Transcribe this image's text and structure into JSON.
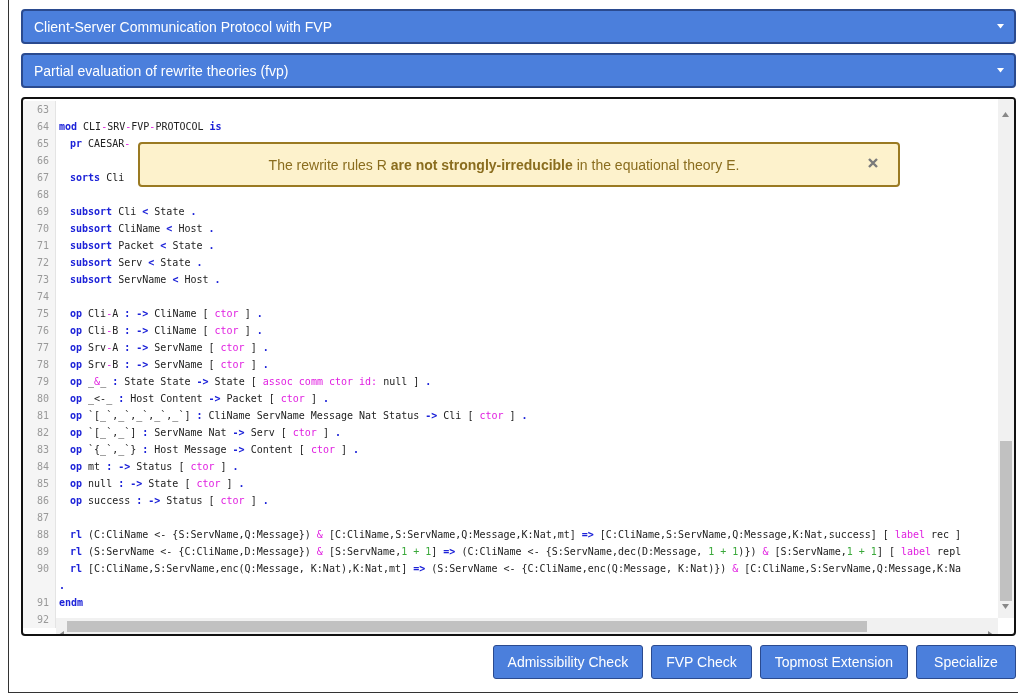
{
  "sections": [
    {
      "title": "Client-Server Communication Protocol with FVP",
      "expanded": false
    },
    {
      "title": "Partial evaluation of rewrite theories (fvp)",
      "expanded": false
    }
  ],
  "editor": {
    "lines": [
      {
        "number": "63"
      },
      {
        "number": "64",
        "indented": false,
        "tokens": [
          {
            "kind": "keyword",
            "text": "mod"
          },
          {
            "kind": "text",
            "text": " CLI"
          },
          {
            "kind": "attribute",
            "text": "-"
          },
          {
            "kind": "text",
            "text": "SRV"
          },
          {
            "kind": "attribute",
            "text": "-"
          },
          {
            "kind": "text",
            "text": "FVP"
          },
          {
            "kind": "attribute",
            "text": "-"
          },
          {
            "kind": "text",
            "text": "PROTOCOL "
          },
          {
            "kind": "keyword",
            "text": "is"
          }
        ]
      },
      {
        "number": "65",
        "indented": true,
        "tokens": [
          {
            "kind": "keyword",
            "text": "pr"
          },
          {
            "kind": "text",
            "text": " CAESAR"
          },
          {
            "kind": "attribute",
            "text": "-"
          }
        ]
      },
      {
        "number": "66"
      },
      {
        "number": "67",
        "indented": true,
        "tokens": [
          {
            "kind": "keyword",
            "text": "sorts"
          },
          {
            "kind": "text",
            "text": " Cli"
          }
        ]
      },
      {
        "number": "68"
      },
      {
        "number": "69",
        "indented": true,
        "tokens": [
          {
            "kind": "keyword",
            "text": "subsort"
          },
          {
            "kind": "text",
            "text": " Cli "
          },
          {
            "kind": "keyword",
            "text": "<"
          },
          {
            "kind": "text",
            "text": " State "
          },
          {
            "kind": "keyword",
            "text": "."
          }
        ]
      },
      {
        "number": "70",
        "indented": true,
        "tokens": [
          {
            "kind": "keyword",
            "text": "subsort"
          },
          {
            "kind": "text",
            "text": " CliName "
          },
          {
            "kind": "keyword",
            "text": "<"
          },
          {
            "kind": "text",
            "text": " Host "
          },
          {
            "kind": "keyword",
            "text": "."
          }
        ]
      },
      {
        "number": "71",
        "indented": true,
        "tokens": [
          {
            "kind": "keyword",
            "text": "subsort"
          },
          {
            "kind": "text",
            "text": " Packet "
          },
          {
            "kind": "keyword",
            "text": "<"
          },
          {
            "kind": "text",
            "text": " State "
          },
          {
            "kind": "keyword",
            "text": "."
          }
        ]
      },
      {
        "number": "72",
        "indented": true,
        "tokens": [
          {
            "kind": "keyword",
            "text": "subsort"
          },
          {
            "kind": "text",
            "text": " Serv "
          },
          {
            "kind": "keyword",
            "text": "<"
          },
          {
            "kind": "text",
            "text": " State "
          },
          {
            "kind": "keyword",
            "text": "."
          }
        ]
      },
      {
        "number": "73",
        "indented": true,
        "tokens": [
          {
            "kind": "keyword",
            "text": "subsort"
          },
          {
            "kind": "text",
            "text": " ServName "
          },
          {
            "kind": "keyword",
            "text": "<"
          },
          {
            "kind": "text",
            "text": " Host "
          },
          {
            "kind": "keyword",
            "text": "."
          }
        ]
      },
      {
        "number": "74"
      },
      {
        "number": "75",
        "indented": true,
        "tokens": [
          {
            "kind": "keyword",
            "text": "op"
          },
          {
            "kind": "text",
            "text": " Cli"
          },
          {
            "kind": "attribute",
            "text": "-"
          },
          {
            "kind": "text",
            "text": "A "
          },
          {
            "kind": "keyword",
            "text": ": ->"
          },
          {
            "kind": "text",
            "text": " CliName [ "
          },
          {
            "kind": "attribute",
            "text": "ctor"
          },
          {
            "kind": "text",
            "text": " ] "
          },
          {
            "kind": "keyword",
            "text": "."
          }
        ]
      },
      {
        "number": "76",
        "indented": true,
        "tokens": [
          {
            "kind": "keyword",
            "text": "op"
          },
          {
            "kind": "text",
            "text": " Cli"
          },
          {
            "kind": "attribute",
            "text": "-"
          },
          {
            "kind": "text",
            "text": "B "
          },
          {
            "kind": "keyword",
            "text": ": ->"
          },
          {
            "kind": "text",
            "text": " CliName [ "
          },
          {
            "kind": "attribute",
            "text": "ctor"
          },
          {
            "kind": "text",
            "text": " ] "
          },
          {
            "kind": "keyword",
            "text": "."
          }
        ]
      },
      {
        "number": "77",
        "indented": true,
        "tokens": [
          {
            "kind": "keyword",
            "text": "op"
          },
          {
            "kind": "text",
            "text": " Srv"
          },
          {
            "kind": "attribute",
            "text": "-"
          },
          {
            "kind": "text",
            "text": "A "
          },
          {
            "kind": "keyword",
            "text": ": ->"
          },
          {
            "kind": "text",
            "text": " ServName [ "
          },
          {
            "kind": "attribute",
            "text": "ctor"
          },
          {
            "kind": "text",
            "text": " ] "
          },
          {
            "kind": "keyword",
            "text": "."
          }
        ]
      },
      {
        "number": "78",
        "indented": true,
        "tokens": [
          {
            "kind": "keyword",
            "text": "op"
          },
          {
            "kind": "text",
            "text": " Srv"
          },
          {
            "kind": "attribute",
            "text": "-"
          },
          {
            "kind": "text",
            "text": "B "
          },
          {
            "kind": "keyword",
            "text": ": ->"
          },
          {
            "kind": "text",
            "text": " ServName [ "
          },
          {
            "kind": "attribute",
            "text": "ctor"
          },
          {
            "kind": "text",
            "text": " ] "
          },
          {
            "kind": "keyword",
            "text": "."
          }
        ]
      },
      {
        "number": "79",
        "indented": true,
        "tokens": [
          {
            "kind": "keyword",
            "text": "op"
          },
          {
            "kind": "text",
            "text": " _"
          },
          {
            "kind": "attribute",
            "text": "&"
          },
          {
            "kind": "text",
            "text": "_ "
          },
          {
            "kind": "keyword",
            "text": ":"
          },
          {
            "kind": "text",
            "text": " State State "
          },
          {
            "kind": "keyword",
            "text": "->"
          },
          {
            "kind": "text",
            "text": " State [ "
          },
          {
            "kind": "attribute",
            "text": "assoc comm ctor id:"
          },
          {
            "kind": "text",
            "text": " null ] "
          },
          {
            "kind": "keyword",
            "text": "."
          }
        ]
      },
      {
        "number": "80",
        "indented": true,
        "tokens": [
          {
            "kind": "keyword",
            "text": "op"
          },
          {
            "kind": "text",
            "text": " _<-_ "
          },
          {
            "kind": "keyword",
            "text": ":"
          },
          {
            "kind": "text",
            "text": " Host Content "
          },
          {
            "kind": "keyword",
            "text": "->"
          },
          {
            "kind": "text",
            "text": " Packet [ "
          },
          {
            "kind": "attribute",
            "text": "ctor"
          },
          {
            "kind": "text",
            "text": " ] "
          },
          {
            "kind": "keyword",
            "text": "."
          }
        ]
      },
      {
        "number": "81",
        "indented": true,
        "tokens": [
          {
            "kind": "keyword",
            "text": "op"
          },
          {
            "kind": "text",
            "text": " `[_`,_`,_`,_`,_`] "
          },
          {
            "kind": "keyword",
            "text": ":"
          },
          {
            "kind": "text",
            "text": " CliName ServName Message Nat Status "
          },
          {
            "kind": "keyword",
            "text": "->"
          },
          {
            "kind": "text",
            "text": " Cli [ "
          },
          {
            "kind": "attribute",
            "text": "ctor"
          },
          {
            "kind": "text",
            "text": " ] "
          },
          {
            "kind": "keyword",
            "text": "."
          }
        ]
      },
      {
        "number": "82",
        "indented": true,
        "tokens": [
          {
            "kind": "keyword",
            "text": "op"
          },
          {
            "kind": "text",
            "text": " `[_`,_`] "
          },
          {
            "kind": "keyword",
            "text": ":"
          },
          {
            "kind": "text",
            "text": " ServName Nat "
          },
          {
            "kind": "keyword",
            "text": "->"
          },
          {
            "kind": "text",
            "text": " Serv [ "
          },
          {
            "kind": "attribute",
            "text": "ctor"
          },
          {
            "kind": "text",
            "text": " ] "
          },
          {
            "kind": "keyword",
            "text": "."
          }
        ]
      },
      {
        "number": "83",
        "indented": true,
        "tokens": [
          {
            "kind": "keyword",
            "text": "op"
          },
          {
            "kind": "text",
            "text": " `{_`,_`} "
          },
          {
            "kind": "keyword",
            "text": ":"
          },
          {
            "kind": "text",
            "text": " Host Message "
          },
          {
            "kind": "keyword",
            "text": "->"
          },
          {
            "kind": "text",
            "text": " Content [ "
          },
          {
            "kind": "attribute",
            "text": "ctor"
          },
          {
            "kind": "text",
            "text": " ] "
          },
          {
            "kind": "keyword",
            "text": "."
          }
        ]
      },
      {
        "number": "84",
        "indented": true,
        "tokens": [
          {
            "kind": "keyword",
            "text": "op"
          },
          {
            "kind": "text",
            "text": " mt "
          },
          {
            "kind": "keyword",
            "text": ": ->"
          },
          {
            "kind": "text",
            "text": " Status [ "
          },
          {
            "kind": "attribute",
            "text": "ctor"
          },
          {
            "kind": "text",
            "text": " ] "
          },
          {
            "kind": "keyword",
            "text": "."
          }
        ]
      },
      {
        "number": "85",
        "indented": true,
        "tokens": [
          {
            "kind": "keyword",
            "text": "op"
          },
          {
            "kind": "text",
            "text": " null "
          },
          {
            "kind": "keyword",
            "text": ": ->"
          },
          {
            "kind": "text",
            "text": " State [ "
          },
          {
            "kind": "attribute",
            "text": "ctor"
          },
          {
            "kind": "text",
            "text": " ] "
          },
          {
            "kind": "keyword",
            "text": "."
          }
        ]
      },
      {
        "number": "86",
        "indented": true,
        "tokens": [
          {
            "kind": "keyword",
            "text": "op"
          },
          {
            "kind": "text",
            "text": " success "
          },
          {
            "kind": "keyword",
            "text": ": ->"
          },
          {
            "kind": "text",
            "text": " Status [ "
          },
          {
            "kind": "attribute",
            "text": "ctor"
          },
          {
            "kind": "text",
            "text": " ] "
          },
          {
            "kind": "keyword",
            "text": "."
          }
        ]
      },
      {
        "number": "87"
      },
      {
        "number": "88",
        "indented": true,
        "tokens": [
          {
            "kind": "keyword",
            "text": "rl"
          },
          {
            "kind": "text",
            "text": " (C:CliName <- {S:ServName,Q:Message}) "
          },
          {
            "kind": "attribute",
            "text": "&"
          },
          {
            "kind": "text",
            "text": " [C:CliName,S:ServName,Q:Message,K:Nat,mt] "
          },
          {
            "kind": "keyword",
            "text": "=>"
          },
          {
            "kind": "text",
            "text": " [C:CliName,S:ServName,Q:Message,K:Nat,success] [ "
          },
          {
            "kind": "attribute",
            "text": "label"
          },
          {
            "kind": "text",
            "text": " rec ]"
          }
        ]
      },
      {
        "number": "89",
        "indented": true,
        "tokens": [
          {
            "kind": "keyword",
            "text": "rl"
          },
          {
            "kind": "text",
            "text": " (S:ServName <- {C:CliName,D:Message}) "
          },
          {
            "kind": "attribute",
            "text": "&"
          },
          {
            "kind": "text",
            "text": " [S:ServName,"
          },
          {
            "kind": "number",
            "text": "1 + 1"
          },
          {
            "kind": "text",
            "text": "] "
          },
          {
            "kind": "keyword",
            "text": "=>"
          },
          {
            "kind": "text",
            "text": " (C:CliName <- {S:ServName,dec(D:Message, "
          },
          {
            "kind": "number",
            "text": "1 + 1"
          },
          {
            "kind": "text",
            "text": ")}) "
          },
          {
            "kind": "attribute",
            "text": "&"
          },
          {
            "kind": "text",
            "text": " [S:ServName,"
          },
          {
            "kind": "number",
            "text": "1 + 1"
          },
          {
            "kind": "text",
            "text": "] [ "
          },
          {
            "kind": "attribute",
            "text": "label"
          },
          {
            "kind": "text",
            "text": " repl"
          }
        ]
      },
      {
        "number": "90",
        "indented": true,
        "tokens": [
          {
            "kind": "keyword",
            "text": "rl"
          },
          {
            "kind": "text",
            "text": " [C:CliName,S:ServName,enc(Q:Message, K:Nat),K:Nat,mt] "
          },
          {
            "kind": "keyword",
            "text": "=>"
          },
          {
            "kind": "text",
            "text": " (S:ServName <- {C:CliName,enc(Q:Message, K:Nat)}) "
          },
          {
            "kind": "attribute",
            "text": "&"
          },
          {
            "kind": "text",
            "text": " [C:CliName,S:ServName,Q:Message,K:Na"
          }
        ]
      },
      {
        "indented": false,
        "tokens": [
          {
            "kind": "keyword",
            "text": "."
          }
        ]
      },
      {
        "number": "91",
        "indented": false,
        "tokens": [
          {
            "kind": "keyword",
            "text": "endm"
          }
        ]
      },
      {
        "number": "92"
      }
    ]
  },
  "alert": {
    "message": "The rewrite rules R **are not strongly-irreducible** in the equational theory E."
  },
  "buttons": [
    "Admissibility Check",
    "FVP Check",
    "Topmost Extension",
    "Specialize"
  ]
}
